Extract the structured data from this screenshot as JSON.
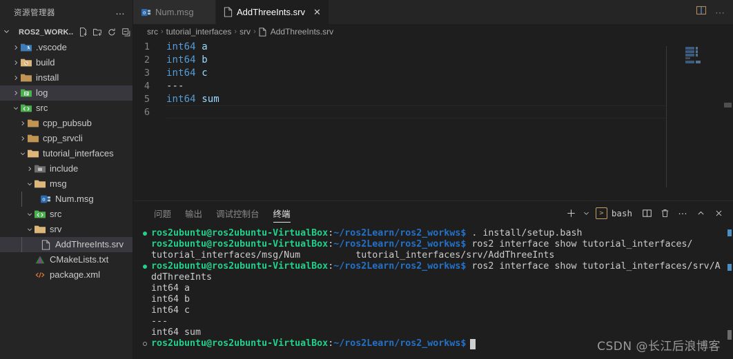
{
  "sidebar": {
    "title": "资源管理器",
    "more_label": "…",
    "project": {
      "name": "ROS2_WORK...",
      "actions": [
        "new-file",
        "new-folder",
        "refresh",
        "collapse-all"
      ]
    },
    "tree": [
      {
        "label": ".vscode",
        "type": "folder",
        "indent": 1,
        "expanded": false,
        "icon": "folder-vscode",
        "color": "#3f7cb5",
        "selected": false
      },
      {
        "label": "build",
        "type": "folder",
        "indent": 1,
        "expanded": false,
        "icon": "folder-build",
        "color": "#dcb67a",
        "selected": false
      },
      {
        "label": "install",
        "type": "folder",
        "indent": 1,
        "expanded": false,
        "icon": "folder-plain",
        "color": "#c09553",
        "selected": false
      },
      {
        "label": "log",
        "type": "folder",
        "indent": 1,
        "expanded": false,
        "icon": "folder-log",
        "color": "#4caf50",
        "selected": true
      },
      {
        "label": "src",
        "type": "folder",
        "indent": 1,
        "expanded": true,
        "icon": "folder-src",
        "color": "#4caf50",
        "selected": false
      },
      {
        "label": "cpp_pubsub",
        "type": "folder",
        "indent": 2,
        "expanded": false,
        "icon": "folder-plain",
        "color": "#c09553",
        "selected": false
      },
      {
        "label": "cpp_srvcli",
        "type": "folder",
        "indent": 2,
        "expanded": false,
        "icon": "folder-plain",
        "color": "#c09553",
        "selected": false
      },
      {
        "label": "tutorial_interfaces",
        "type": "folder",
        "indent": 2,
        "expanded": true,
        "icon": "folder-open",
        "color": "#dcb67a",
        "selected": false
      },
      {
        "label": "include",
        "type": "folder",
        "indent": 3,
        "expanded": false,
        "icon": "folder-include",
        "color": "#8a8a8a",
        "selected": false
      },
      {
        "label": "msg",
        "type": "folder",
        "indent": 3,
        "expanded": true,
        "icon": "folder-open",
        "color": "#dcb67a",
        "selected": false
      },
      {
        "label": "Num.msg",
        "type": "file",
        "indent": 4,
        "expanded": null,
        "icon": "msg-file-icon",
        "color": "#3f7cb5",
        "selected": false
      },
      {
        "label": "src",
        "type": "folder",
        "indent": 3,
        "expanded": true,
        "icon": "folder-src",
        "color": "#4caf50",
        "selected": false
      },
      {
        "label": "srv",
        "type": "folder",
        "indent": 3,
        "expanded": true,
        "icon": "folder-open",
        "color": "#dcb67a",
        "selected": false
      },
      {
        "label": "AddThreeInts.srv",
        "type": "file",
        "indent": 4,
        "expanded": null,
        "icon": "document-icon",
        "color": "#c5c5c5",
        "selected": true
      },
      {
        "label": "CMakeLists.txt",
        "type": "file",
        "indent": 3,
        "expanded": null,
        "icon": "cmake-icon",
        "color": "#d44",
        "selected": false
      },
      {
        "label": "package.xml",
        "type": "file",
        "indent": 3,
        "expanded": null,
        "icon": "xml-icon",
        "color": "#e37933",
        "selected": false
      }
    ]
  },
  "tabs": [
    {
      "label": "Num.msg",
      "icon": "msg-file-icon",
      "active": false,
      "closable": false
    },
    {
      "label": "AddThreeInts.srv",
      "icon": "document-icon",
      "active": true,
      "closable": true,
      "close_label": "✕"
    }
  ],
  "tabbar_actions": [
    {
      "name": "split-editor-icon"
    },
    {
      "name": "more-actions-icon",
      "label": "…"
    }
  ],
  "breadcrumb": {
    "separator": "›",
    "items": [
      "src",
      "tutorial_interfaces",
      "srv",
      "AddThreeInts.srv"
    ],
    "file_icon": "document-icon"
  },
  "editor": {
    "lines": [
      {
        "num": "1",
        "tokens": [
          {
            "t": "int64",
            "c": "kw"
          },
          {
            "t": " ",
            "c": "pl"
          },
          {
            "t": "a",
            "c": "id"
          }
        ]
      },
      {
        "num": "2",
        "tokens": [
          {
            "t": "int64",
            "c": "kw"
          },
          {
            "t": " ",
            "c": "pl"
          },
          {
            "t": "b",
            "c": "id"
          }
        ]
      },
      {
        "num": "3",
        "tokens": [
          {
            "t": "int64",
            "c": "kw"
          },
          {
            "t": " ",
            "c": "pl"
          },
          {
            "t": "c",
            "c": "id"
          }
        ]
      },
      {
        "num": "4",
        "tokens": [
          {
            "t": "---",
            "c": "pl"
          }
        ]
      },
      {
        "num": "5",
        "tokens": [
          {
            "t": "int64",
            "c": "kw"
          },
          {
            "t": " ",
            "c": "pl"
          },
          {
            "t": "sum",
            "c": "id"
          }
        ]
      },
      {
        "num": "6",
        "tokens": []
      }
    ],
    "cursor_line": 6
  },
  "panel": {
    "tabs": [
      {
        "label": "问题",
        "active": false
      },
      {
        "label": "输出",
        "active": false
      },
      {
        "label": "调试控制台",
        "active": false
      },
      {
        "label": "终端",
        "active": true
      }
    ],
    "actions": {
      "new_terminal": "+",
      "new_terminal_dropdown": "chevron-down-icon",
      "shell_name": "bash",
      "shell_icon": ">",
      "split": "split-terminal-icon",
      "kill": "trash-icon",
      "more": "…",
      "maximize": "chevron-up-icon",
      "close": "✕"
    }
  },
  "terminal": {
    "prompt": {
      "user": "ros2ubuntu@ros2ubuntu-VirtualBox",
      "colon": ":",
      "path": "~/ros2Learn/ros2_workws",
      "dollar": "$"
    },
    "lines": [
      {
        "kind": "prompt",
        "deco": "dot-ok",
        "command": " . install/setup.bash"
      },
      {
        "kind": "prompt",
        "deco": "none",
        "command": " ros2 interface show tutorial_interfaces/"
      },
      {
        "kind": "output",
        "deco": "none",
        "text": "tutorial_interfaces/msg/Num          tutorial_interfaces/srv/AddThreeInts"
      },
      {
        "kind": "prompt",
        "deco": "dot-ok",
        "command": " ros2 interface show tutorial_interfaces/srv/A"
      },
      {
        "kind": "output",
        "deco": "none",
        "text": "ddThreeInts"
      },
      {
        "kind": "output",
        "deco": "none",
        "text": "int64 a"
      },
      {
        "kind": "output",
        "deco": "none",
        "text": "int64 b"
      },
      {
        "kind": "output",
        "deco": "none",
        "text": "int64 c"
      },
      {
        "kind": "output",
        "deco": "none",
        "text": "---"
      },
      {
        "kind": "output",
        "deco": "none",
        "text": "int64 sum"
      },
      {
        "kind": "prompt",
        "deco": "dot-ring",
        "command": "",
        "cursor": true
      }
    ]
  },
  "watermark": "CSDN @长江后浪博客",
  "colors": {
    "editor_bg": "#1e1e1e",
    "sidebar_bg": "#252526",
    "tab_inactive_bg": "#2d2d2d",
    "selection_bg": "#37373d",
    "keyword": "#569cd6",
    "identifier": "#9cdcfe",
    "terminal_green": "#23d18b",
    "terminal_blue": "#2472c8",
    "folder_yellow": "#dcb67a"
  }
}
